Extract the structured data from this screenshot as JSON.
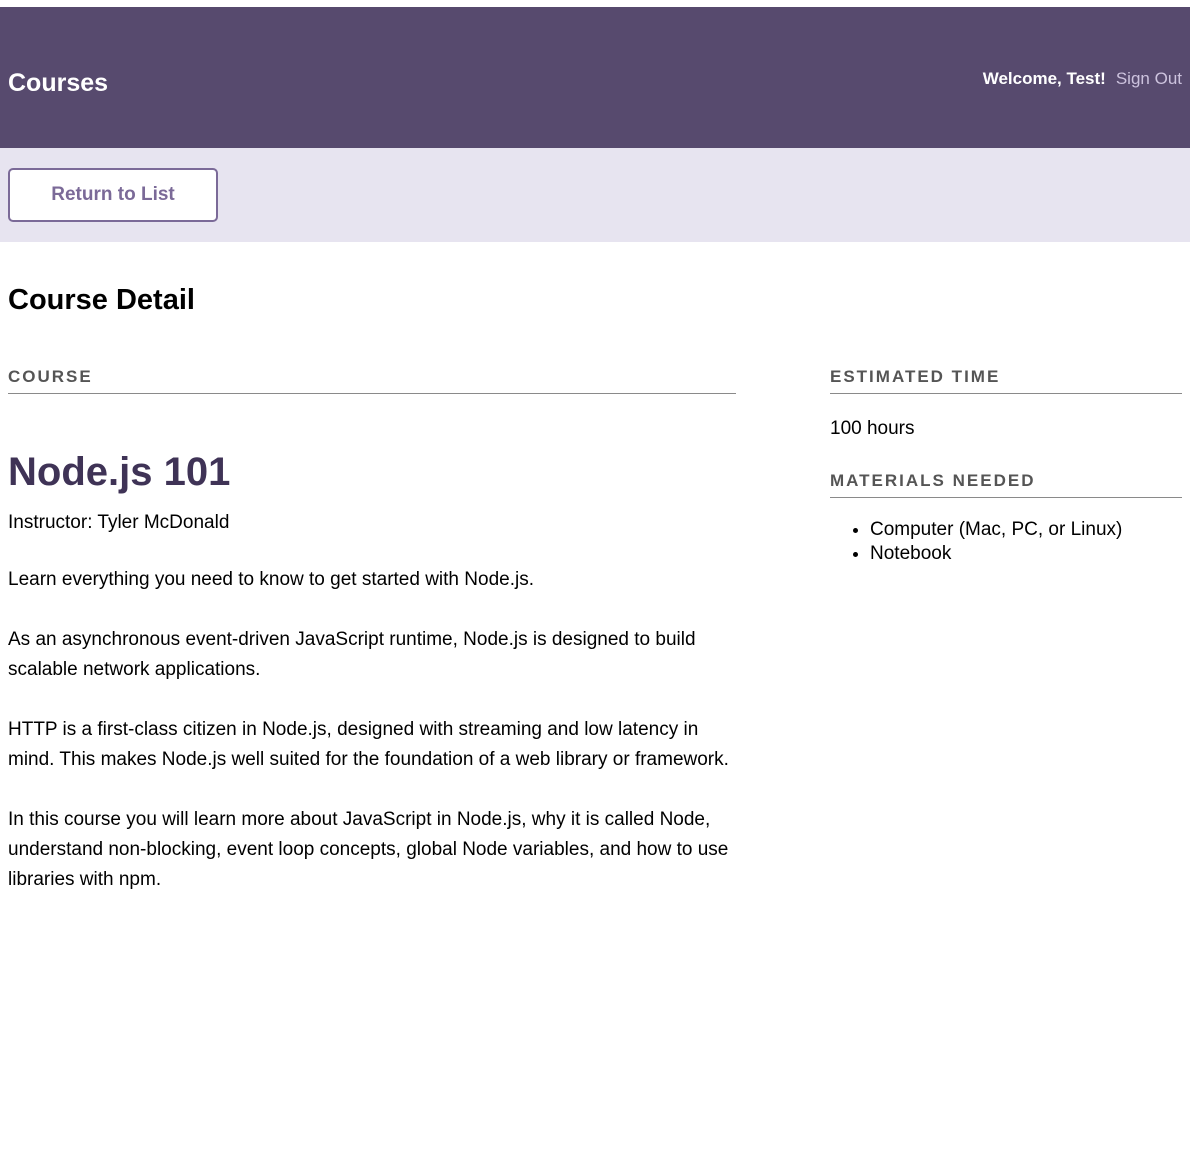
{
  "header": {
    "logo": "Courses",
    "welcome": "Welcome, Test!",
    "sign_out": "Sign Out"
  },
  "actions": {
    "return_label": "Return to List"
  },
  "page_title": "Course Detail",
  "course": {
    "section_label": "Course",
    "title": "Node.js 101",
    "instructor": "Instructor: Tyler McDonald",
    "description": [
      "Learn everything you need to know to get started with Node.js.",
      "As an asynchronous event-driven JavaScript runtime, Node.js is designed to build scalable network applications.",
      "HTTP is a first-class citizen in Node.js, designed with streaming and low latency in mind. This makes Node.js well suited for the foundation of a web library or framework.",
      "In this course you will learn more about JavaScript in Node.js, why it is called Node, understand non-blocking, event loop concepts, global Node variables, and how to use libraries with npm."
    ]
  },
  "sidebar": {
    "estimated_time_label": "Estimated Time",
    "estimated_time": "100 hours",
    "materials_label": "Materials Needed",
    "materials": [
      "Computer (Mac, PC, or Linux)",
      "Notebook"
    ]
  },
  "colors": {
    "header_bg": "#574a6e",
    "actions_bg": "#e7e4f0",
    "accent": "#7b6a98",
    "course_title": "#3f3356"
  }
}
